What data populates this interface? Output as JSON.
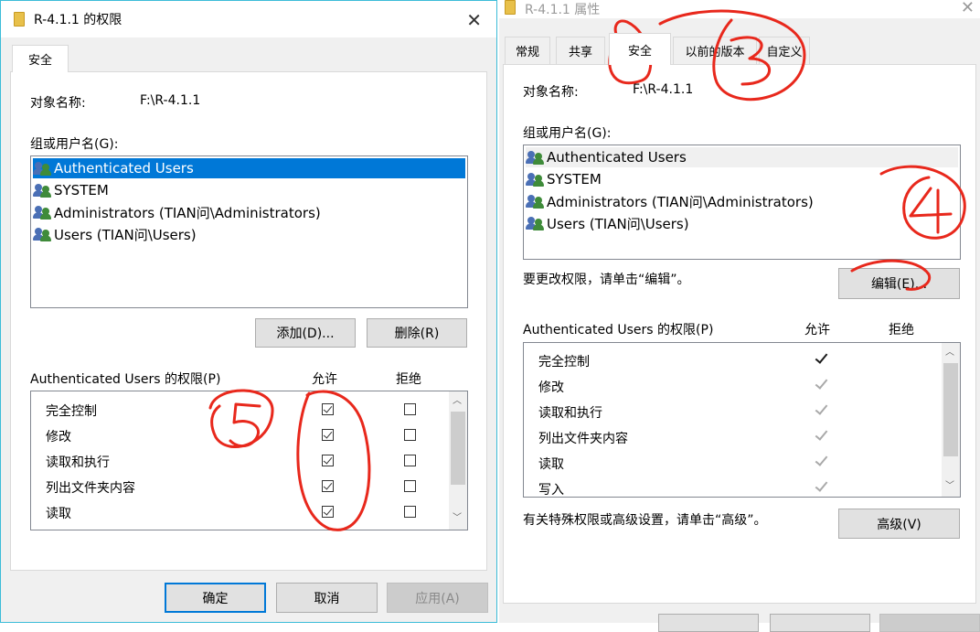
{
  "left_dialog": {
    "title": "R-4.1.1 的权限",
    "tab": "安全",
    "object_label": "对象名称:",
    "object_value": "F:\\R-4.1.1",
    "group_label": "组或用户名(G):",
    "users": [
      "Authenticated Users",
      "SYSTEM",
      "Administrators (TIAN问\\Administrators)",
      "Users (TIAN问\\Users)"
    ],
    "selected_user_index": 0,
    "add_button": "添加(D)...",
    "remove_button": "删除(R)",
    "perm_header": "Authenticated Users 的权限(P)",
    "allow_header": "允许",
    "deny_header": "拒绝",
    "permissions": [
      {
        "name": "完全控制",
        "allow": true,
        "deny": false
      },
      {
        "name": "修改",
        "allow": true,
        "deny": false
      },
      {
        "name": "读取和执行",
        "allow": true,
        "deny": false
      },
      {
        "name": "列出文件夹内容",
        "allow": true,
        "deny": false
      },
      {
        "name": "读取",
        "allow": true,
        "deny": false
      }
    ],
    "ok_button": "确定",
    "cancel_button": "取消",
    "apply_button": "应用(A)"
  },
  "right_dialog": {
    "title": "R-4.1.1 属性",
    "tabs": [
      "常规",
      "共享",
      "安全",
      "以前的版本",
      "自定义"
    ],
    "active_tab_index": 2,
    "object_label": "对象名称:",
    "object_value": "F:\\R-4.1.1",
    "group_label": "组或用户名(G):",
    "users": [
      "Authenticated Users",
      "SYSTEM",
      "Administrators (TIAN问\\Administrators)",
      "Users (TIAN问\\Users)"
    ],
    "edit_hint": "要更改权限，请单击“编辑”。",
    "edit_button": "编辑(E)...",
    "perm_header": "Authenticated Users 的权限(P)",
    "allow_header": "允许",
    "deny_header": "拒绝",
    "permissions": [
      {
        "name": "完全控制",
        "allow": true,
        "inherited": false
      },
      {
        "name": "修改",
        "allow": true,
        "inherited": true
      },
      {
        "name": "读取和执行",
        "allow": true,
        "inherited": true
      },
      {
        "name": "列出文件夹内容",
        "allow": true,
        "inherited": true
      },
      {
        "name": "读取",
        "allow": true,
        "inherited": true
      },
      {
        "name": "写入",
        "allow": true,
        "inherited": true
      }
    ],
    "advanced_hint": "有关特殊权限或高级设置，请单击“高级”。",
    "advanced_button": "高级(V)"
  },
  "annotations": {
    "color": "#e8281c",
    "labels": [
      "3",
      "4",
      "5"
    ]
  },
  "colors": {
    "selection": "#0078d7",
    "left_title_bar": "#3cbcd8",
    "annotation_red": "#e8281c"
  }
}
